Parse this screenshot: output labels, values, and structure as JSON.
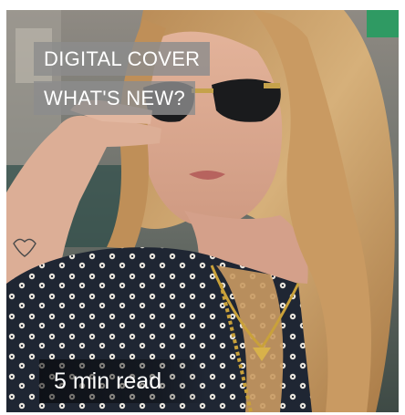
{
  "card": {
    "tags": [
      "DIGITAL COVER",
      "WHAT'S NEW?"
    ],
    "read_time": "5 min read"
  },
  "colors": {
    "tag_background": "#8c8c8c",
    "hair": "#c9a06a",
    "blouse": "#1f2633",
    "skin": "#d8a98f"
  }
}
